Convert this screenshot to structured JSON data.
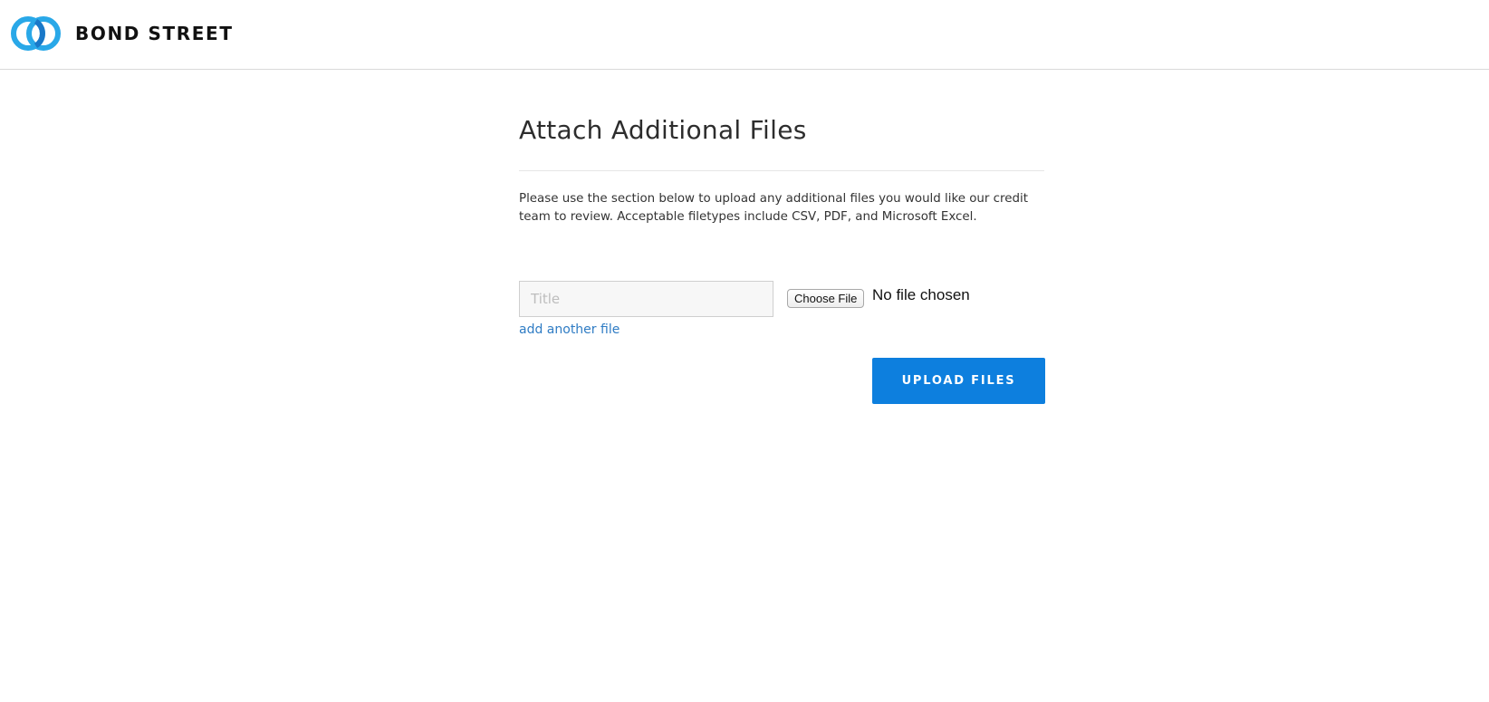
{
  "brand": {
    "name": "BOND STREET",
    "logo_icon": "interlocking-rings-icon",
    "logo_color_light": "#29a8e8",
    "logo_color_dark": "#1a78c8"
  },
  "page": {
    "title": "Attach Additional Files",
    "instructions": "Please use the section below to upload any additional files you would like our credit team to review. Acceptable filetypes include CSV, PDF, and Microsoft Excel."
  },
  "form": {
    "title_input": {
      "value": "",
      "placeholder": "Title"
    },
    "choose_file_label": "Choose File",
    "file_status": "No file chosen",
    "add_another_label": "add another file",
    "upload_label": "UPLOAD FILES"
  },
  "colors": {
    "accent": "#0d7fde",
    "link": "#2f7cc4"
  }
}
